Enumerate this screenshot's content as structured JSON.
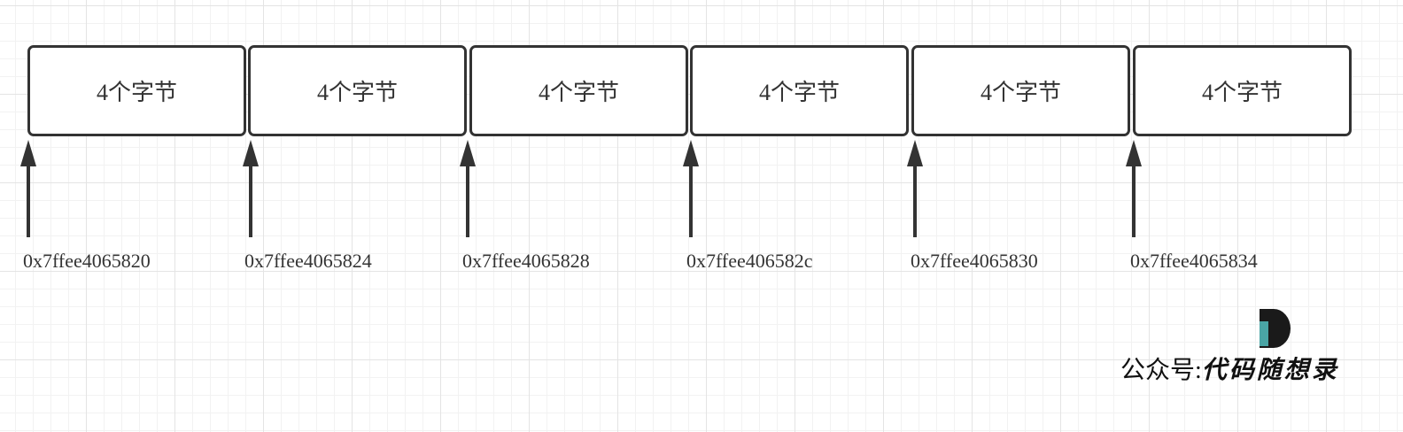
{
  "memory": {
    "cells": [
      {
        "label": "4个字节",
        "address": "0x7ffee4065820"
      },
      {
        "label": "4个字节",
        "address": "0x7ffee4065824"
      },
      {
        "label": "4个字节",
        "address": "0x7ffee4065828"
      },
      {
        "label": "4个字节",
        "address": "0x7ffee406582c"
      },
      {
        "label": "4个字节",
        "address": "0x7ffee4065830"
      },
      {
        "label": "4个字节",
        "address": "0x7ffee4065834"
      }
    ]
  },
  "watermark": {
    "prefix": "公众号:",
    "brand": "代码随想录",
    "logo_letter": "D"
  },
  "colors": {
    "stroke": "#333333",
    "logo_dark": "#1a1a1a",
    "logo_accent": "#4aa5a5"
  }
}
